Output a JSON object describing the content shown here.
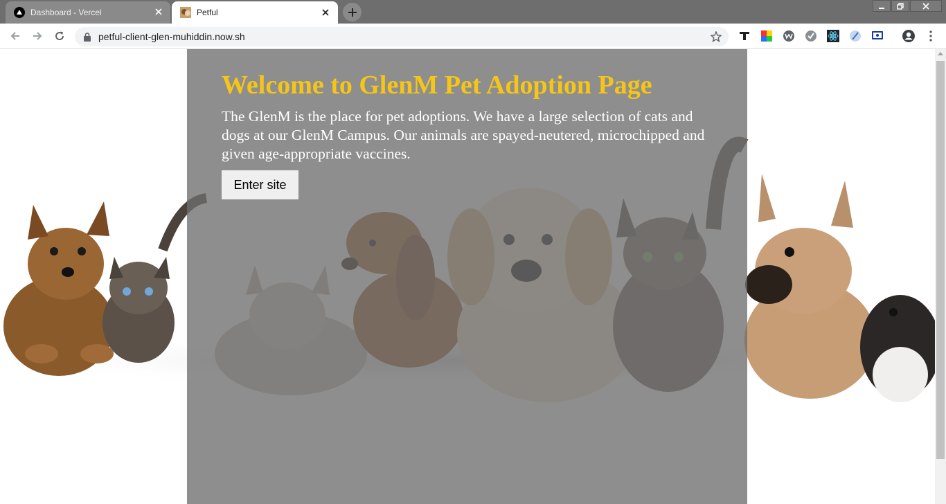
{
  "browser": {
    "tabs": [
      {
        "title": "Dashboard - Vercel",
        "active": false,
        "favicon": "vercel-icon"
      },
      {
        "title": "Petful",
        "active": true,
        "favicon": "pet-photo-icon"
      }
    ],
    "address_bar": {
      "url": "petful-client-glen-muhiddin.now.sh"
    },
    "extensions": [
      "text-tool-icon",
      "color-picker-icon",
      "w-extension-icon",
      "check-extension-icon",
      "react-devtools-icon",
      "feather-extension-icon",
      "screen-extension-icon",
      "profile-icon",
      "menu-icon"
    ]
  },
  "page": {
    "heading": "Welcome to GlenM Pet Adoption Page",
    "intro": "The GlenM is the place for pet adoptions. We have a large selection of cats and dogs at our GlenM Campus. Our animals are spayed-neutered, microchipped and given age-appropriate vaccines.",
    "enter_button": "Enter site",
    "background_image": "puppies-and-kittens-photo"
  },
  "colors": {
    "heading": "#f5c518",
    "overlay": "#6e6e6e",
    "tabstrip": "#6e6e6e"
  }
}
